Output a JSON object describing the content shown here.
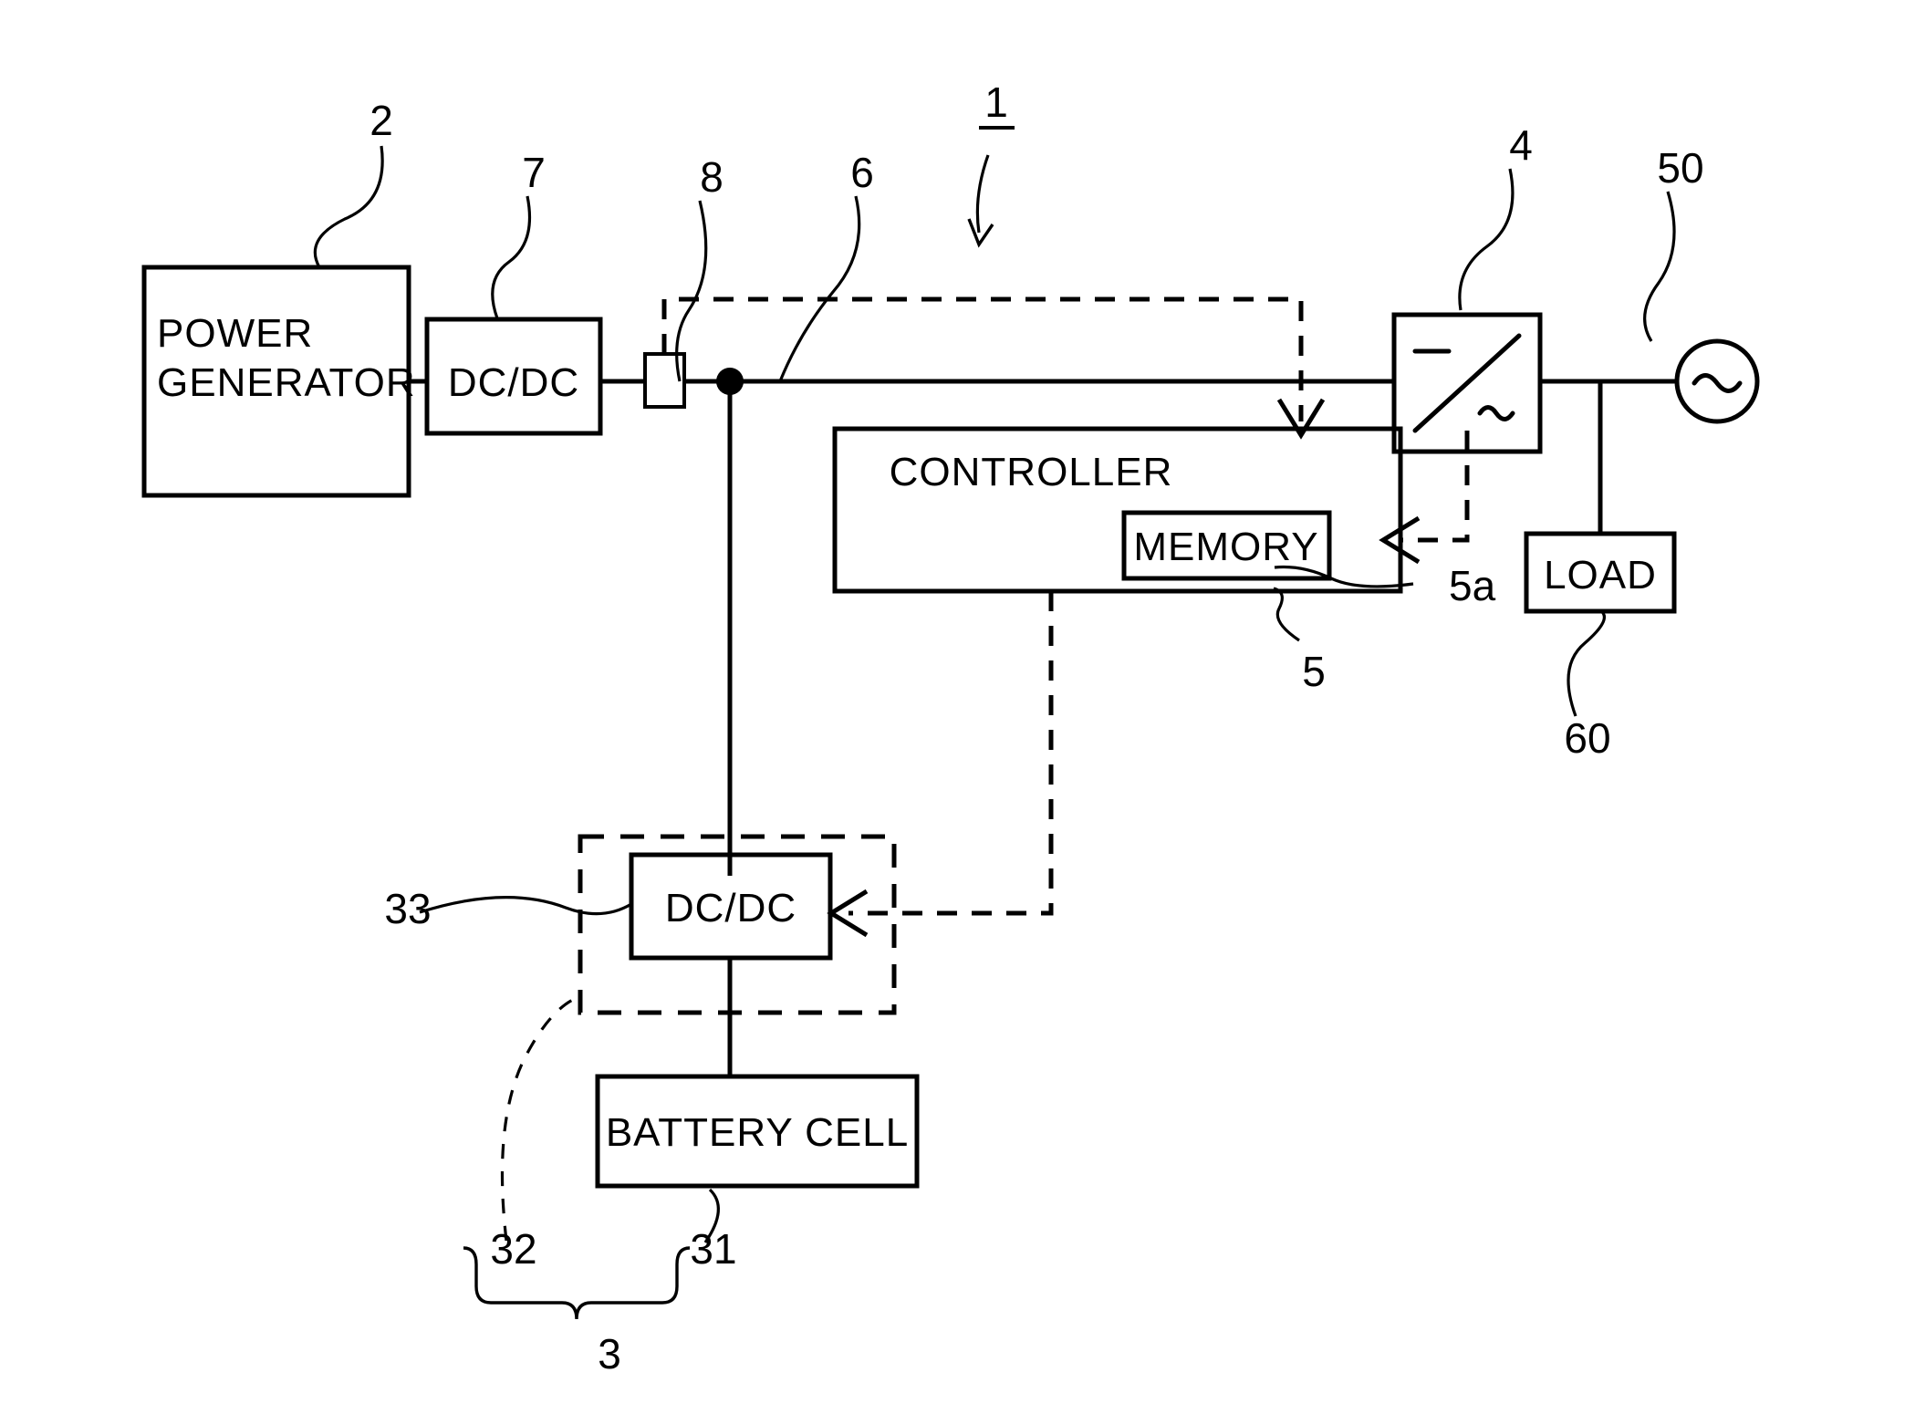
{
  "figure": {
    "title": "Power supply system block diagram",
    "type": "patent-block-diagram",
    "background_color": "#ffffff",
    "line_color": "#000000"
  },
  "blocks": {
    "power_generator": "POWER\nGENERATOR",
    "power_generator_line1": "POWER",
    "power_generator_line2": "GENERATOR",
    "dcdc_input": "DC/DC",
    "controller": "CONTROLLER",
    "memory": "MEMORY",
    "load": "LOAD",
    "dcdc_battery": "DC/DC",
    "battery_cell": "BATTERY CELL",
    "inverter_dc_symbol": "—",
    "inverter_ac_symbol": "~",
    "ac_source_symbol": "~"
  },
  "reference_numerals": {
    "system": "1",
    "power_generator": "2",
    "battery_module": "3",
    "inverter": "4",
    "controller": "5",
    "memory": "5a",
    "dc_bus": "6",
    "dcdc_input": "7",
    "sensor": "8",
    "battery_cell": "31",
    "battery_dcdc_group": "32",
    "battery_dcdc": "33",
    "ac_grid": "50",
    "load": "60"
  }
}
